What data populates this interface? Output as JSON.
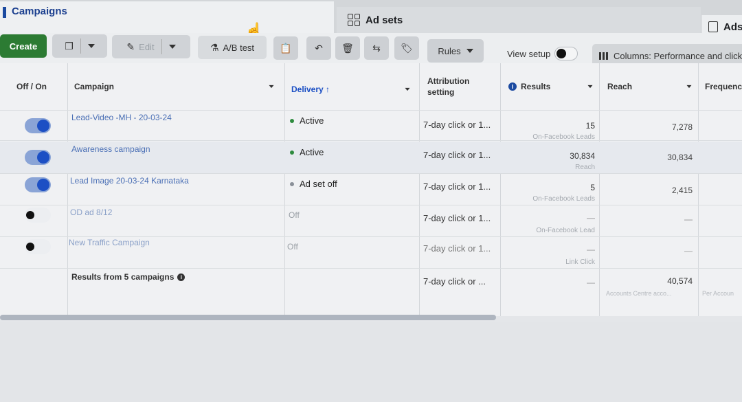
{
  "tabs": {
    "campaigns": "Campaigns",
    "ad_sets": "Ad sets",
    "ads": "Ads"
  },
  "toolbar": {
    "create": "Create",
    "edit": "Edit",
    "ab_test": "A/B test",
    "rules": "Rules",
    "view_setup": "View setup",
    "columns": "Columns: Performance and clicks"
  },
  "headers": {
    "off_on": "Off / On",
    "campaign": "Campaign",
    "delivery": "Delivery ↑",
    "attribution": "Attribution setting",
    "results": "Results",
    "reach": "Reach",
    "frequency": "Frequency"
  },
  "rows": [
    {
      "on": true,
      "name": "Lead-Video -MH - 20-03-24",
      "delivery": "Active",
      "delivery_color": "#2e8b3e",
      "attribution": "7-day click or 1...",
      "results": "15",
      "results_sub": "On-Facebook Leads",
      "reach": "7,278"
    },
    {
      "on": true,
      "name": "Awareness campaign",
      "delivery": "Active",
      "delivery_color": "#2e8b3e",
      "attribution": "7-day click or 1...",
      "results": "30,834",
      "results_sub": "Reach",
      "reach": "30,834"
    },
    {
      "on": true,
      "name": "Lead Image 20-03-24 Karnataka",
      "delivery": "Ad set off",
      "delivery_color": "#8a9098",
      "attribution": "7-day click or 1...",
      "results": "5",
      "results_sub": "On-Facebook Leads",
      "reach": "2,415"
    },
    {
      "on": false,
      "name": "OD ad 8/12",
      "delivery": "Off",
      "delivery_color": "",
      "attribution": "7-day click or 1...",
      "results": "—",
      "results_sub": "On-Facebook Lead",
      "reach": "—"
    },
    {
      "on": false,
      "name": "New Traffic Campaign",
      "delivery": "Off",
      "delivery_color": "",
      "attribution": "7-day click or 1...",
      "results": "—",
      "results_sub": "Link Click",
      "reach": "—"
    }
  ],
  "summary": {
    "label": "Results from 5 campaigns",
    "attribution": "7-day click or ...",
    "results": "—",
    "reach": "40,574",
    "reach_sub": "Accounts Centre acco...",
    "freq_sub": "Per Accoun"
  }
}
